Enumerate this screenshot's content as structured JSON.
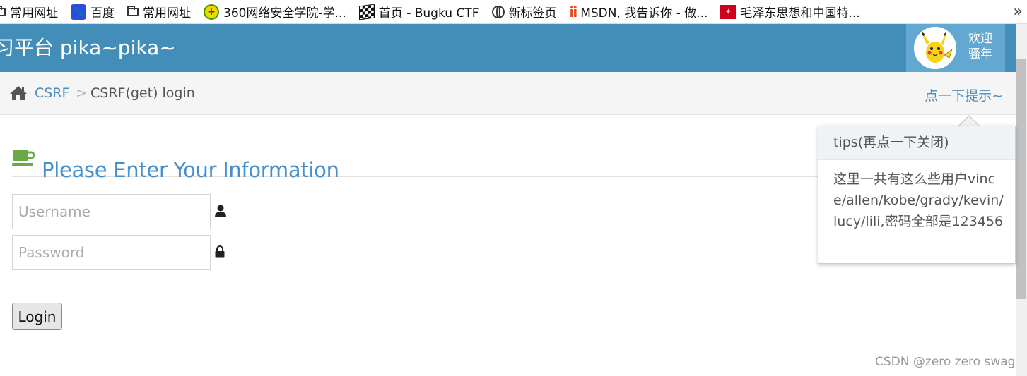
{
  "bookmarks": [
    {
      "label": "常用网址",
      "icon": "folder-icon"
    },
    {
      "label": "百度",
      "icon": "baidu-paw-icon"
    },
    {
      "label": "常用网址",
      "icon": "folder-icon"
    },
    {
      "label": "360网络安全学院-学...",
      "icon": "360-icon"
    },
    {
      "label": "首页 - Bugku CTF",
      "icon": "checkered-flag-icon"
    },
    {
      "label": "新标签页",
      "icon": "globe-icon"
    },
    {
      "label": "MSDN, 我告诉你 - 做...",
      "icon": "msdn-icon"
    },
    {
      "label": "毛泽东思想和中国特...",
      "icon": "red-square-icon"
    }
  ],
  "header": {
    "brand": "习平台 pika~pika~",
    "welcome_line1": "欢迎",
    "welcome_line2": "骚年"
  },
  "breadcrumb": {
    "link": "CSRF",
    "separator": ">",
    "current": "CSRF(get) login",
    "hint": "点一下提示~"
  },
  "main": {
    "title": "Please Enter Your Information",
    "username_placeholder": "Username",
    "password_placeholder": "Password",
    "login_label": "Login"
  },
  "popover": {
    "title": "tips(再点一下关闭)",
    "body": "这里一共有这么些用户vince/allen/kobe/grady/kevin/lucy/lili,密码全部是123456"
  },
  "watermark": "CSDN @zero zero swag",
  "colors": {
    "header_bg": "#438eb9",
    "user_box_bg": "#62a8d1",
    "link": "#4c8fbd",
    "title": "#478fca",
    "cup_icon": "#69aa46"
  }
}
